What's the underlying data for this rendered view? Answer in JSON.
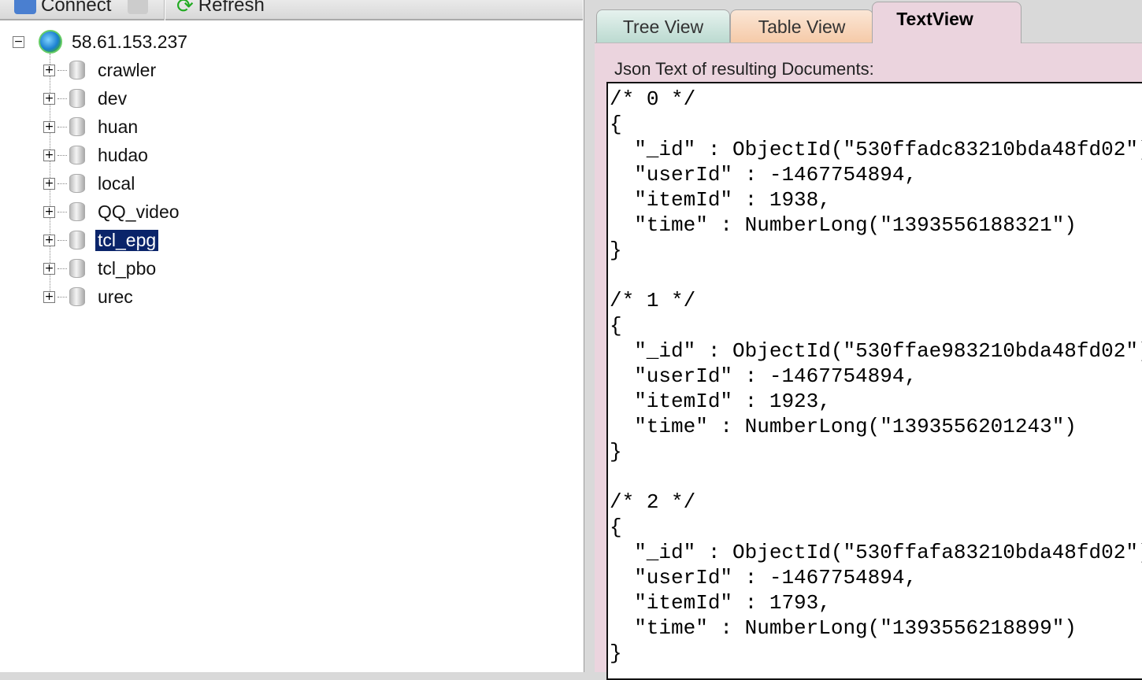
{
  "toolbar": {
    "connect_label": "Connect",
    "refresh_label": "Refresh"
  },
  "tree": {
    "server": "58.61.153.237",
    "databases": [
      "crawler",
      "dev",
      "huan",
      "hudao",
      "local",
      "QQ_video",
      "tcl_epg",
      "tcl_pbo",
      "urec"
    ],
    "selected": "tcl_epg"
  },
  "tabs": [
    {
      "label": "Tree View"
    },
    {
      "label": "Table View"
    },
    {
      "label": "TextView"
    }
  ],
  "panel": {
    "label": "Json Text of resulting Documents:"
  },
  "documents": [
    {
      "index": "0",
      "id": "530ffadc83210bda48fd02",
      "userId": "-1467754894",
      "itemId": "1938",
      "time": "1393556188321"
    },
    {
      "index": "1",
      "id": "530ffae983210bda48fd02",
      "userId": "-1467754894",
      "itemId": "1923",
      "time": "1393556201243"
    },
    {
      "index": "2",
      "id": "530ffafa83210bda48fd02",
      "userId": "-1467754894",
      "itemId": "1793",
      "time": "1393556218899"
    }
  ]
}
